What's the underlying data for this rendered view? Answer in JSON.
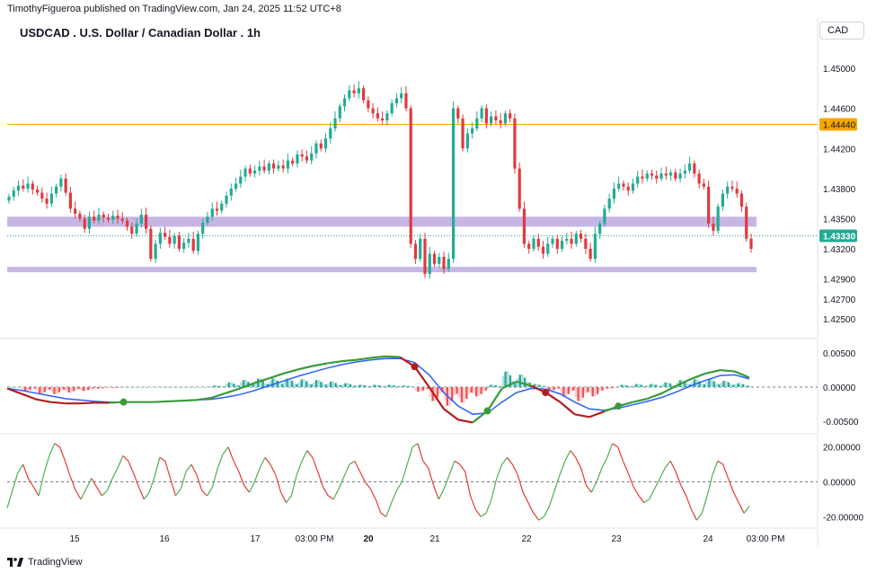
{
  "header": {
    "published_by": "TimothyFigueroa published on TradingView.com, Jan 24, 2025 11:52 UTC+8"
  },
  "symbol": {
    "title": "USDCAD . U.S. Dollar / Canadian Dollar . 1h",
    "currency": "CAD"
  },
  "footer": {
    "brand": "TradingView"
  },
  "colors": {
    "up": "#22ab94",
    "down": "#e03a3e",
    "zone": "#b39ddb",
    "resistance": "#f7a600",
    "macd_fast": "#3a9a3a",
    "macd_signal": "#2962ff",
    "macd_dark": "#b71c1c"
  },
  "x_axis": {
    "labels": [
      "15",
      "16",
      "17",
      "03:00 PM",
      "20",
      "21",
      "22",
      "23",
      "24",
      "03:00 PM"
    ],
    "bold": [
      "20"
    ]
  },
  "chart_data": [
    {
      "type": "candlestick",
      "pane": "price",
      "ylim": [
        1.4235,
        1.4525
      ],
      "y_ticks": [
        "1.45000",
        "1.44600",
        "1.44200",
        "1.43800",
        "1.43500",
        "1.43200",
        "1.42900",
        "1.42700",
        "1.42500"
      ],
      "resistance_level": "1.44440",
      "current_price": "1.43330",
      "support_zones": [
        [
          1.4342,
          1.4352
        ],
        [
          1.4297,
          1.4302
        ]
      ],
      "close": [
        1.4372,
        1.4378,
        1.4383,
        1.438,
        1.4385,
        1.4379,
        1.4376,
        1.437,
        1.4365,
        1.4375,
        1.4382,
        1.439,
        1.4376,
        1.436,
        1.4355,
        1.435,
        1.434,
        1.4352,
        1.4348,
        1.4354,
        1.4351,
        1.4349,
        1.4353,
        1.435,
        1.4348,
        1.4342,
        1.4335,
        1.4345,
        1.4354,
        1.434,
        1.431,
        1.4325,
        1.4336,
        1.4332,
        1.4325,
        1.4333,
        1.432,
        1.4326,
        1.433,
        1.4318,
        1.4335,
        1.4346,
        1.4352,
        1.436,
        1.4358,
        1.4365,
        1.4373,
        1.438,
        1.4385,
        1.4392,
        1.44,
        1.4395,
        1.4398,
        1.4402,
        1.4398,
        1.4405,
        1.44,
        1.4403,
        1.44,
        1.4408,
        1.4405,
        1.4414,
        1.4412,
        1.4408,
        1.4415,
        1.4425,
        1.442,
        1.443,
        1.444,
        1.445,
        1.4462,
        1.447,
        1.4478,
        1.4475,
        1.448,
        1.4468,
        1.446,
        1.4455,
        1.445,
        1.4448,
        1.4455,
        1.4465,
        1.447,
        1.4475,
        1.446,
        1.4325,
        1.431,
        1.433,
        1.4295,
        1.4315,
        1.4305,
        1.4312,
        1.43,
        1.431,
        1.446,
        1.445,
        1.442,
        1.4435,
        1.444,
        1.445,
        1.446,
        1.4445,
        1.4452,
        1.4448,
        1.4445,
        1.4455,
        1.445,
        1.44,
        1.436,
        1.4325,
        1.432,
        1.433,
        1.4322,
        1.4315,
        1.4325,
        1.433,
        1.432,
        1.4328,
        1.433,
        1.4325,
        1.4335,
        1.433,
        1.432,
        1.431,
        1.4335,
        1.4345,
        1.436,
        1.437,
        1.438,
        1.4385,
        1.4382,
        1.4378,
        1.4385,
        1.4392,
        1.439,
        1.4395,
        1.4393,
        1.439,
        1.4395,
        1.4393,
        1.4396,
        1.439,
        1.4395,
        1.4398,
        1.4405,
        1.4395,
        1.4385,
        1.4382,
        1.4345,
        1.4338,
        1.4362,
        1.4375,
        1.4382,
        1.438,
        1.4375,
        1.4362,
        1.433,
        1.432
      ],
      "y_axis_label_bg": [
        "#f7a600",
        "#22ab94"
      ]
    },
    {
      "type": "line",
      "pane": "macd",
      "ylim": [
        -0.0062,
        0.0062
      ],
      "y_ticks": [
        "0.00500",
        "0.00000",
        "-0.00500"
      ],
      "series": [
        {
          "name": "",
          "values": [
            -0.0002,
            -0.001,
            -0.0018,
            -0.0022,
            -0.0024,
            -0.0024,
            -0.0023,
            -0.0023,
            -0.0022,
            -0.0022,
            -0.0022,
            -0.0021,
            -0.002,
            -0.0019,
            -0.0016,
            -0.0009,
            -0.0002,
            0.0006,
            0.0013,
            0.002,
            0.0026,
            0.0031,
            0.0035,
            0.0038,
            0.004,
            0.0043,
            0.0045,
            0.0044,
            0.003,
            0.0,
            -0.0032,
            -0.0048,
            -0.0052,
            -0.0035,
            -0.0002,
            0.0008,
            0.0002,
            -0.0008,
            -0.0022,
            -0.004,
            -0.0044,
            -0.0036,
            -0.0028,
            -0.0022,
            -0.0017,
            -0.0009,
            0.0002,
            0.0012,
            0.002,
            0.0025,
            0.0023,
            0.0014
          ]
        },
        {
          "name": "",
          "values": [
            -0.0002,
            -0.0005,
            -0.0009,
            -0.0013,
            -0.0017,
            -0.0019,
            -0.0021,
            -0.0022,
            -0.0022,
            -0.0022,
            -0.0022,
            -0.0021,
            -0.002,
            -0.0019,
            -0.0018,
            -0.0015,
            -0.0011,
            -0.0005,
            0.0002,
            0.0009,
            0.0016,
            0.0022,
            0.0028,
            0.0033,
            0.0037,
            0.004,
            0.0042,
            0.0042,
            0.0036,
            0.0018,
            -0.0008,
            -0.0028,
            -0.004,
            -0.0038,
            -0.0022,
            -0.0008,
            -0.0002,
            -0.0003,
            -0.001,
            -0.0022,
            -0.0032,
            -0.0034,
            -0.0031,
            -0.0026,
            -0.0021,
            -0.0015,
            -0.0007,
            0.0002,
            0.001,
            0.0017,
            0.0018,
            0.0012
          ]
        }
      ],
      "histogram": [
        0,
        0,
        0,
        0,
        0,
        0,
        0,
        0,
        0,
        0,
        0,
        0,
        0,
        0,
        0,
        0,
        0,
        0,
        0,
        0,
        0,
        0,
        0,
        0,
        0,
        0,
        0,
        0,
        0,
        0,
        0,
        0,
        0,
        0,
        0,
        0,
        0,
        0,
        0,
        0,
        0,
        0,
        0,
        0,
        0,
        0,
        0,
        0,
        0,
        0,
        0,
        0
      ]
    },
    {
      "type": "line",
      "pane": "oscillator",
      "ylim": [
        -25,
        25
      ],
      "y_ticks": [
        "20.00000",
        "0.00000",
        "-20.00000"
      ],
      "values": [
        -15,
        -5,
        5,
        10,
        2,
        -3,
        -8,
        5,
        15,
        22,
        20,
        12,
        3,
        -5,
        -10,
        -4,
        2,
        -3,
        -8,
        -5,
        2,
        8,
        15,
        12,
        5,
        -3,
        -10,
        -6,
        3,
        14,
        12,
        2,
        -8,
        -4,
        6,
        10,
        4,
        -5,
        -8,
        -3,
        8,
        16,
        20,
        12,
        6,
        -2,
        -6,
        0,
        8,
        14,
        10,
        4,
        -6,
        -12,
        -8,
        4,
        12,
        18,
        14,
        6,
        -3,
        -8,
        -10,
        -4,
        3,
        10,
        12,
        6,
        0,
        -4,
        -10,
        -18,
        -20,
        -12,
        -5,
        0,
        10,
        20,
        22,
        12,
        8,
        -2,
        -10,
        -4,
        4,
        12,
        10,
        6,
        -8,
        -16,
        -20,
        -18,
        -10,
        2,
        10,
        14,
        10,
        4,
        -6,
        -12,
        -18,
        -22,
        -20,
        -14,
        -5,
        4,
        12,
        18,
        14,
        8,
        -2,
        -6,
        0,
        8,
        14,
        22,
        20,
        12,
        5,
        -3,
        -8,
        -12,
        -10,
        -4,
        2,
        8,
        12,
        6,
        -2,
        -8,
        -16,
        -22,
        -18,
        -8,
        4,
        12,
        10,
        2,
        -6,
        -12,
        -18,
        -14
      ]
    }
  ]
}
